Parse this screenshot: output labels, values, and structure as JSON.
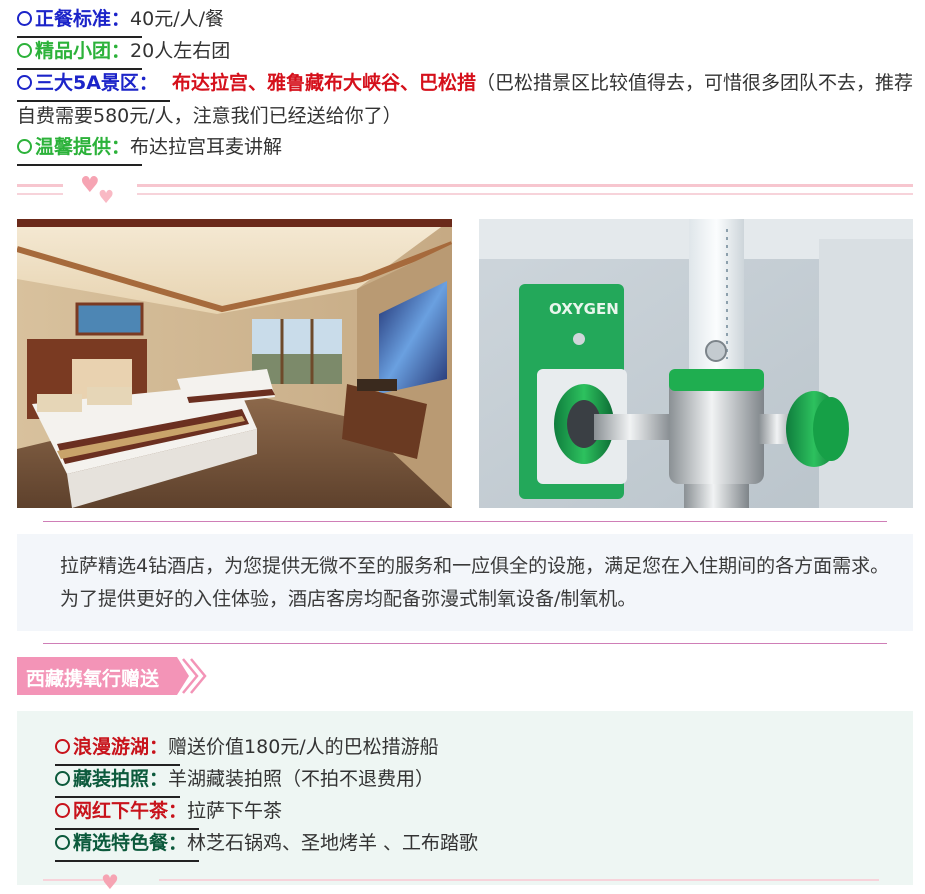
{
  "features": [
    {
      "label": "正餐标准：",
      "value": "40元/人/餐",
      "color": "#1c24c9"
    },
    {
      "label": "精品小团：",
      "value": "20人左右团",
      "color": "#2cb23a"
    },
    {
      "label": "三大5A景区：",
      "highlight": "布达拉宫、雅鲁藏布大峡谷、巴松措",
      "value": "（巴松措景区比较值得去，可惜很多团队不去，推荐自费需要580元/人，注意我们已经送给你了）",
      "color": "#1c24c9"
    },
    {
      "label": "温馨提供：",
      "value": "布达拉宫耳麦讲解",
      "color": "#2cb23a"
    }
  ],
  "photos": [
    {
      "icon": "hotel-room-image"
    },
    {
      "icon": "oxygen-regulator-image",
      "sign_text": "OXYGEN"
    }
  ],
  "hotel_note": "拉萨精选4钻酒店，为您提供无微不至的服务和一应俱全的设施，满足您在入住期间的各方面需求。为了提供更好的入住体验，酒店客房均配备弥漫式制氧设备/制氧机。",
  "ribbon_title": "西藏携氧行赠送",
  "gifts": [
    {
      "label": "浪漫游湖：",
      "value": "赠送价值180元/人的巴松措游船",
      "color": "#c8131b"
    },
    {
      "label": "藏装拍照：",
      "value": "羊湖藏装拍照（不拍不退费用）",
      "color": "#0c5a3c"
    },
    {
      "label": "网红下午茶：",
      "value": "拉萨下午茶",
      "color": "#c8131b"
    },
    {
      "label": "精选特色餐：",
      "value": "林芝石锅鸡、圣地烤羊 、工布踏歌",
      "color": "#0c5a3c"
    }
  ]
}
